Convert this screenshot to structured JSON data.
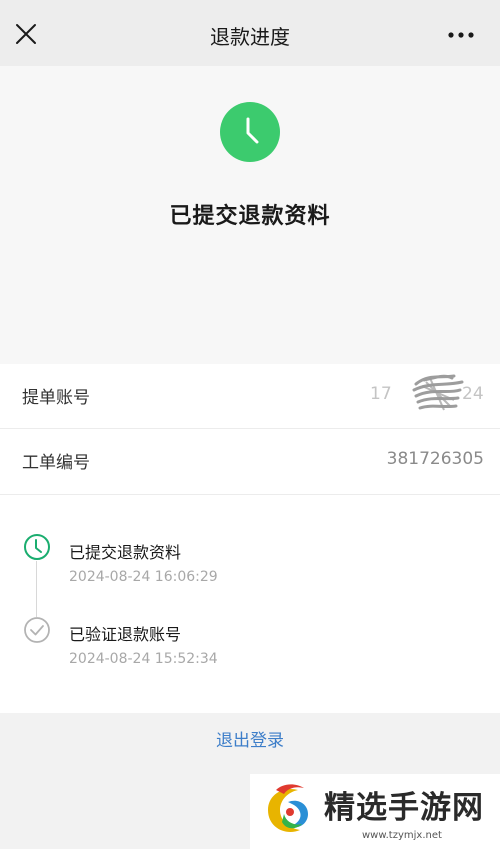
{
  "nav": {
    "title": "退款进度",
    "close_icon": "close-icon",
    "more_icon": "more-icon"
  },
  "hero": {
    "status_icon": "clock-icon",
    "status_color": "#3ccb6e",
    "title": "已提交退款资料"
  },
  "info": {
    "account_label": "提单账号",
    "account_value_prefix": "17",
    "account_value_suffix": "24",
    "ticket_label": "工单编号",
    "ticket_value": "381726305"
  },
  "timeline": {
    "items": [
      {
        "title": "已提交退款资料",
        "time": "2024-08-24 16:06:29",
        "icon": "clock-icon",
        "color": "#1aad6f"
      },
      {
        "title": "已验证退款账号",
        "time": "2024-08-24 15:52:34",
        "icon": "check-circle-icon",
        "color": "#b3b3b3"
      }
    ]
  },
  "footer": {
    "logout_label": "退出登录"
  },
  "watermark": {
    "text": "精选手游网",
    "url": "www.tzymjx.net"
  }
}
